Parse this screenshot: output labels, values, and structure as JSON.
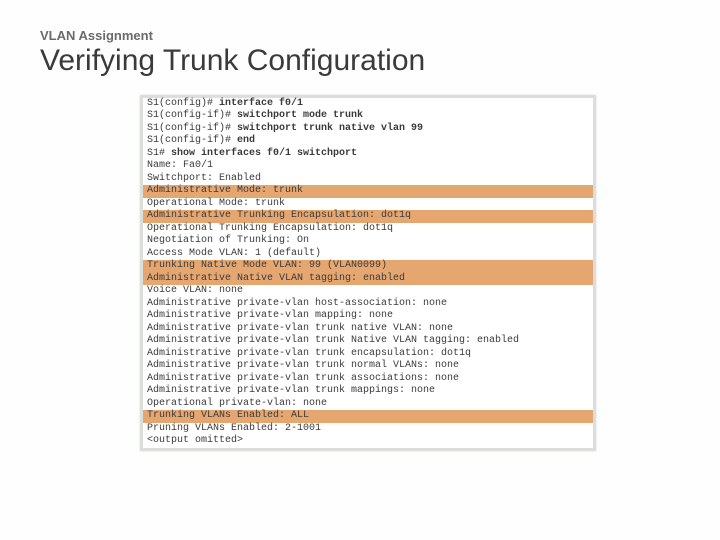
{
  "kicker": "VLAN Assignment",
  "title": "Verifying Trunk Configuration",
  "terminal": {
    "lines": [
      {
        "hl": false,
        "text": "S1(config)# ",
        "bold": "interface f0/1"
      },
      {
        "hl": false,
        "text": "S1(config-if)# ",
        "bold": "switchport mode trunk"
      },
      {
        "hl": false,
        "text": "S1(config-if)# ",
        "bold": "switchport trunk native vlan 99"
      },
      {
        "hl": false,
        "text": "S1(config-if)# ",
        "bold": "end"
      },
      {
        "hl": false,
        "text": "S1# ",
        "bold": "show interfaces f0/1 switchport"
      },
      {
        "hl": false,
        "text": "Name: Fa0/1"
      },
      {
        "hl": false,
        "text": "Switchport: Enabled"
      },
      {
        "hl": true,
        "text": "Administrative Mode: trunk"
      },
      {
        "hl": false,
        "text": "Operational Mode: trunk"
      },
      {
        "hl": true,
        "text": "Administrative Trunking Encapsulation: dot1q"
      },
      {
        "hl": false,
        "text": "Operational Trunking Encapsulation: dot1q"
      },
      {
        "hl": false,
        "text": "Negotiation of Trunking: On"
      },
      {
        "hl": false,
        "text": "Access Mode VLAN: 1 (default)"
      },
      {
        "hl": true,
        "text": "Trunking Native Mode VLAN: 99 (VLAN0099)"
      },
      {
        "hl": true,
        "text": "Administrative Native VLAN tagging: enabled"
      },
      {
        "hl": false,
        "text": "Voice VLAN: none"
      },
      {
        "hl": false,
        "text": "Administrative private-vlan host-association: none"
      },
      {
        "hl": false,
        "text": "Administrative private-vlan mapping: none"
      },
      {
        "hl": false,
        "text": "Administrative private-vlan trunk native VLAN: none"
      },
      {
        "hl": false,
        "text": "Administrative private-vlan trunk Native VLAN tagging: enabled"
      },
      {
        "hl": false,
        "text": "Administrative private-vlan trunk encapsulation: dot1q"
      },
      {
        "hl": false,
        "text": "Administrative private-vlan trunk normal VLANs: none"
      },
      {
        "hl": false,
        "text": "Administrative private-vlan trunk associations: none"
      },
      {
        "hl": false,
        "text": "Administrative private-vlan trunk mappings: none"
      },
      {
        "hl": false,
        "text": "Operational private-vlan: none"
      },
      {
        "hl": true,
        "text": "Trunking VLANs Enabled: ALL"
      },
      {
        "hl": false,
        "text": "Pruning VLANs Enabled: 2-1001"
      },
      {
        "hl": false,
        "text": "<output omitted>"
      }
    ]
  }
}
